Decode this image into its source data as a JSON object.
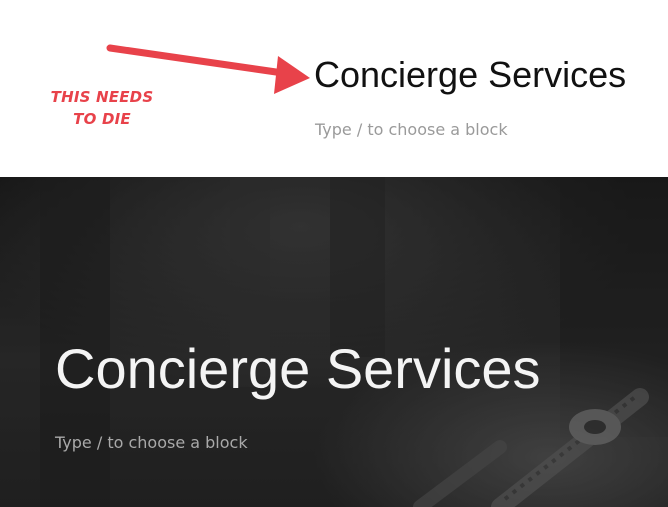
{
  "annotation": {
    "text": "THIS NEEDS\nTO DIE",
    "color": "#e8424a"
  },
  "top_block": {
    "title": "Concierge Services",
    "placeholder": "Type / to choose a block"
  },
  "hero_block": {
    "title": "Concierge Services",
    "placeholder": "Type / to choose a block"
  },
  "colors": {
    "hero_overlay": "#2b2b2b",
    "title_dark": "#111111",
    "title_light": "#f4f4f4",
    "placeholder": "#9a9a9a"
  }
}
